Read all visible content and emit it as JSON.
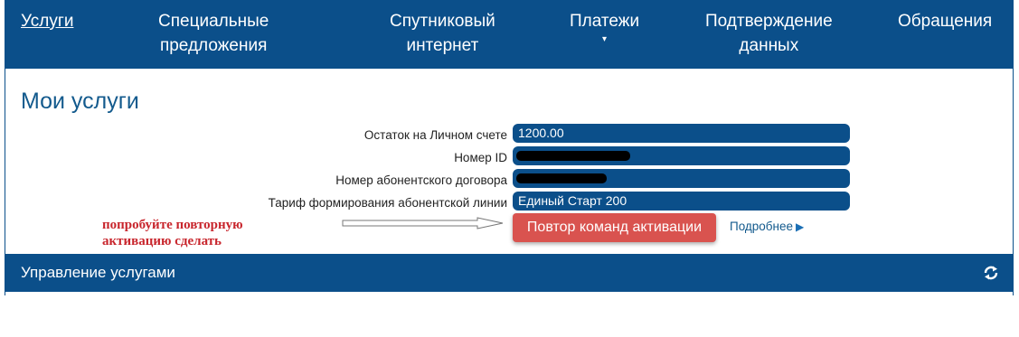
{
  "nav": {
    "items": [
      {
        "label_line1": "Услуги",
        "label_line2": ""
      },
      {
        "label_line1": "Специальные",
        "label_line2": "предложения"
      },
      {
        "label_line1": "Спутниковый",
        "label_line2": "интернет"
      },
      {
        "label_line1": "Платежи",
        "label_line2": ""
      },
      {
        "label_line1": "Подтверждение",
        "label_line2": "данных"
      },
      {
        "label_line1": "Обращения",
        "label_line2": ""
      }
    ],
    "payments_caret": "▾"
  },
  "page_title": "Мои услуги",
  "info": {
    "balance_label": "Остаток на Личном счете",
    "balance_value": "1200.00",
    "id_label": "Номер ID",
    "contract_label": "Номер абонентского договора",
    "tariff_label": "Тариф формирования абонентской линии",
    "tariff_value": "Единый Старт 200"
  },
  "annotation": {
    "line1": "попробуйте повторную",
    "line2": "активацию сделать"
  },
  "actions": {
    "repeat_button": "Повтор команд активации",
    "more_link": "Подробнее",
    "more_icon": "▶"
  },
  "section": {
    "title": "Управление услугами",
    "icon": "refresh-icon"
  },
  "colors": {
    "brand_blue": "#0b4f8a",
    "button_red": "#d9534f",
    "annotation_red": "#c8262d"
  }
}
